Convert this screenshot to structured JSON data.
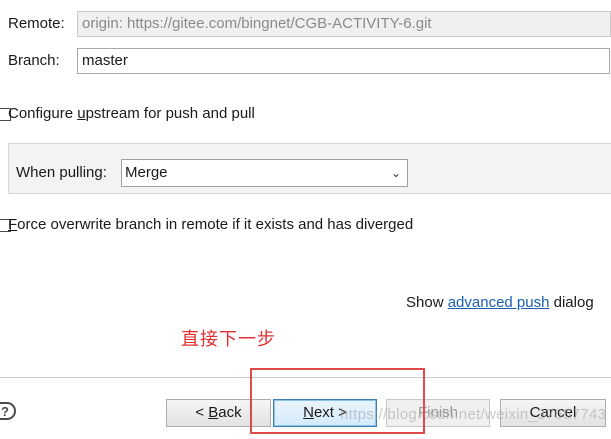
{
  "remote": {
    "label": "Remote:",
    "value": "origin: https://gitee.com/bingnet/CGB-ACTIVITY-6.git"
  },
  "branch": {
    "label": "Branch:",
    "value": "master"
  },
  "configure_upstream": {
    "prefix": "Configure ",
    "mnemonic": "u",
    "suffix": "pstream for push and pull",
    "checked": false
  },
  "pulling": {
    "label": "When pulling:",
    "selected": "Merge"
  },
  "force_overwrite": {
    "mnemonic": "F",
    "suffix": "orce overwrite branch in remote if it exists and has diverged",
    "checked": false
  },
  "advanced": {
    "prefix": "Show ",
    "link": "advanced push",
    "suffix": " dialog"
  },
  "annotation": "直接下一步",
  "buttons": {
    "back_prefix": "< ",
    "back_mnemonic": "B",
    "back_suffix": "ack",
    "next_mnemonic": "N",
    "next_suffix": "ext >",
    "finish": "Finish",
    "cancel": "Cancel"
  },
  "watermark": "https://blog.csdn.net/weixin_37657743",
  "help_icon": "?",
  "colors": {
    "annotation": "#e03030",
    "link": "#1a5fb4",
    "highlight_box": "#e04a4a"
  }
}
